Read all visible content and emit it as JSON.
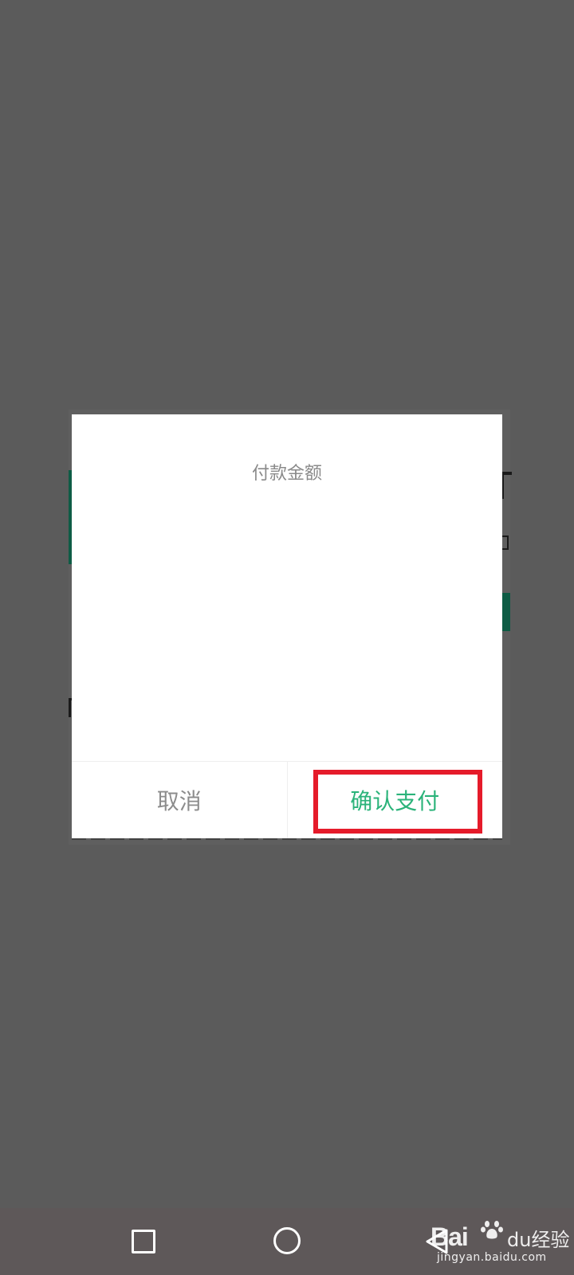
{
  "dialog": {
    "title": "付款金额",
    "cancel_label": "取消",
    "confirm_label": "确认支付"
  },
  "nav": {
    "recents_icon": "square-icon",
    "home_icon": "circle-icon",
    "back_icon": "triangle-back-icon"
  },
  "watermark": {
    "logo": "Bai",
    "logo_suffix": "du",
    "brand_suffix": "经验",
    "url": "jingyan.baidu.com"
  },
  "colors": {
    "overlay": "#5b5b5b",
    "confirm_green": "#2bb37a",
    "cancel_gray": "#8c8c8c",
    "highlight_red": "#e51b2a",
    "bg_accent_green": "#0e5c45"
  }
}
